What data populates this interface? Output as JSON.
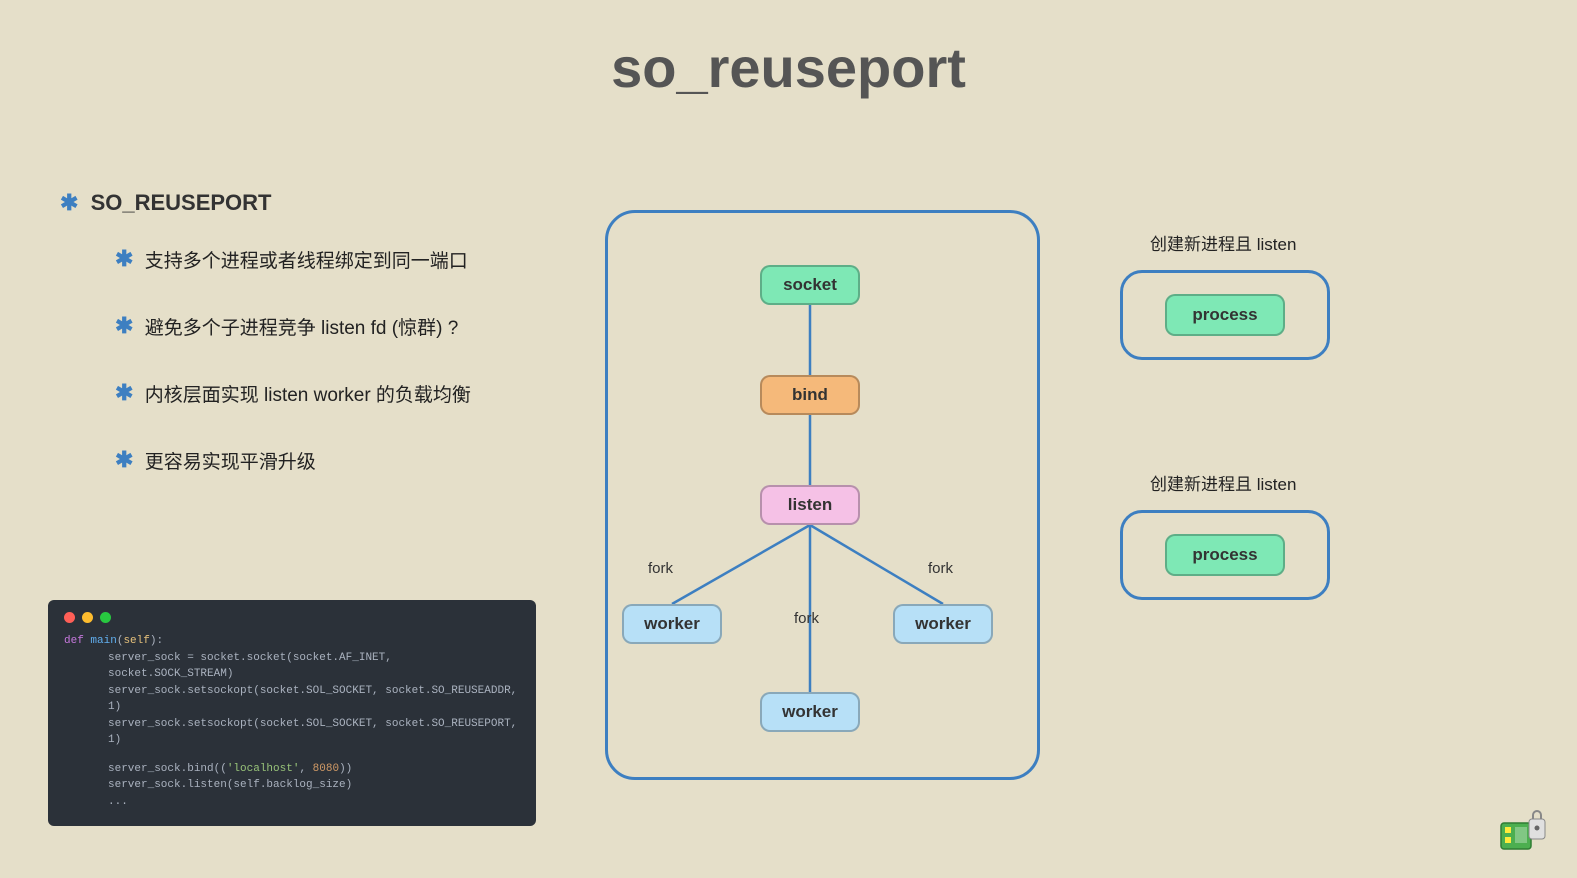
{
  "title": "so_reuseport",
  "heading": "SO_REUSEPORT",
  "bullets": [
    "支持多个进程或者线程绑定到同一端口",
    "避免多个子进程竞争 listen fd (惊群) ?",
    "内核层面实现 listen worker 的负载均衡",
    "更容易实现平滑升级"
  ],
  "code": {
    "def": "def",
    "main": "main",
    "self": "self",
    "lines": [
      "server_sock = socket.socket(socket.AF_INET, socket.SOCK_STREAM)",
      "server_sock.setsockopt(socket.SOL_SOCKET, socket.SO_REUSEADDR, 1)",
      "server_sock.setsockopt(socket.SOL_SOCKET, socket.SO_REUSEPORT, 1)"
    ],
    "bind_host": "'localhost'",
    "bind_port": "8080",
    "bind_pre": "server_sock.bind((",
    "bind_post": "))",
    "listen": "server_sock.listen(self.backlog_size)",
    "ellipsis": "..."
  },
  "diagram": {
    "socket": "socket",
    "bind": "bind",
    "listen": "listen",
    "worker": "worker",
    "fork": "fork"
  },
  "right": {
    "label": "创建新进程且 listen",
    "process": "process"
  }
}
